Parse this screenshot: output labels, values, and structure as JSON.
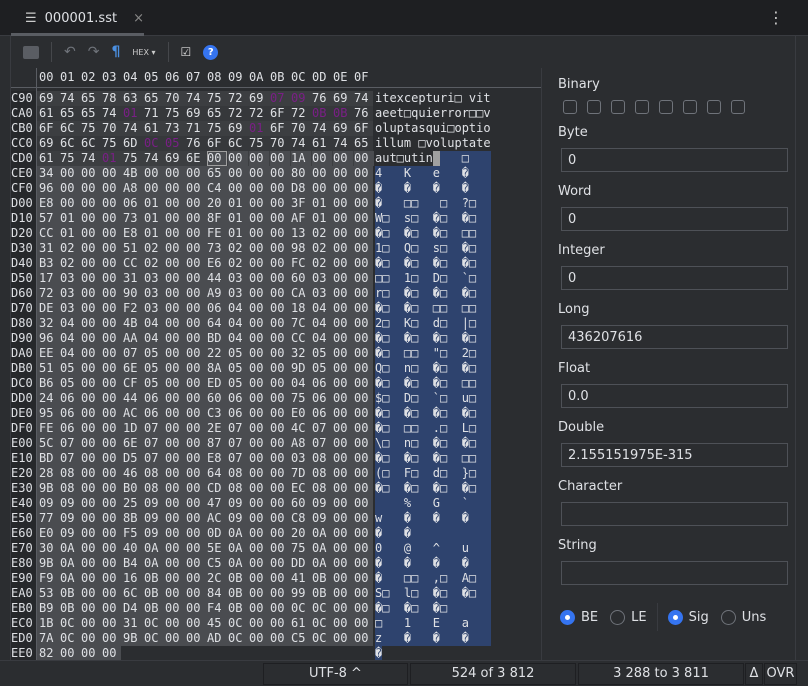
{
  "tab": {
    "title": "000001.sst",
    "close": "×",
    "menu": "⋮"
  },
  "toolbar": {
    "mode": "HEX",
    "icons": [
      "folder-icon",
      "undo-icon",
      "redo-icon",
      "pilcrow-icon",
      "hex-mode-icon",
      "settings-icon",
      "help-icon"
    ]
  },
  "header": [
    "00",
    "01",
    "02",
    "03",
    "04",
    "05",
    "06",
    "07",
    "08",
    "09",
    "0A",
    "0B",
    "0C",
    "0D",
    "0E",
    "0F"
  ],
  "colors": {
    "highlight": "#7a1f86",
    "selection_ascii": "#2e436e",
    "accent": "#3574f0"
  },
  "rows": [
    {
      "o": "C90",
      "h": "69 74 65 78 63 65 70 74 75 72 69 07 09 76 69 74",
      "a": "itexcepturi□ vit"
    },
    {
      "o": "CA0",
      "h": "61 65 65 74 01 71 75 69 65 72 72 6F 72 0B 0B 76",
      "a": "aeet□quierror□□v"
    },
    {
      "o": "CB0",
      "h": "6F 6C 75 70 74 61 73 71 75 69 01 6F 70 74 69 6F",
      "a": "oluptasqui□optio"
    },
    {
      "o": "CC0",
      "h": "69 6C 6C 75 6D 0C 05 76 6F 6C 75 70 74 61 74 65",
      "a": "illum □voluptate"
    },
    {
      "o": "CD0",
      "h": "61 75 74 01 75 74 69 6E 00 00 00 00 1A 00 00 00",
      "a": "aut□utin    □   "
    },
    {
      "o": "CE0",
      "h": "34 00 00 00 4B 00 00 00 65 00 00 00 80 00 00 00",
      "a": "4   K   e   �   "
    },
    {
      "o": "CF0",
      "h": "96 00 00 00 A8 00 00 00 C4 00 00 00 D8 00 00 00",
      "a": "�   �   �   �   "
    },
    {
      "o": "D00",
      "h": "E8 00 00 00 06 01 00 00 20 01 00 00 3F 01 00 00",
      "a": "�   □□   □  ?□  "
    },
    {
      "o": "D10",
      "h": "57 01 00 00 73 01 00 00 8F 01 00 00 AF 01 00 00",
      "a": "W□  s□  �□  �□  "
    },
    {
      "o": "D20",
      "h": "CC 01 00 00 E8 01 00 00 FE 01 00 00 13 02 00 00",
      "a": "�□  �□  �□  □□  "
    },
    {
      "o": "D30",
      "h": "31 02 00 00 51 02 00 00 73 02 00 00 98 02 00 00",
      "a": "1□  Q□  s□  �□  "
    },
    {
      "o": "D40",
      "h": "B3 02 00 00 CC 02 00 00 E6 02 00 00 FC 02 00 00",
      "a": "�□  �□  �□  �□  "
    },
    {
      "o": "D50",
      "h": "17 03 00 00 31 03 00 00 44 03 00 00 60 03 00 00",
      "a": "□□  1□  D□  `□  "
    },
    {
      "o": "D60",
      "h": "72 03 00 00 90 03 00 00 A9 03 00 00 CA 03 00 00",
      "a": "r□  �□  �□  �□  "
    },
    {
      "o": "D70",
      "h": "DE 03 00 00 F2 03 00 00 06 04 00 00 18 04 00 00",
      "a": "�□  �□  □□  □□  "
    },
    {
      "o": "D80",
      "h": "32 04 00 00 4B 04 00 00 64 04 00 00 7C 04 00 00",
      "a": "2□  K□  d□  |□  "
    },
    {
      "o": "D90",
      "h": "96 04 00 00 AA 04 00 00 BD 04 00 00 CC 04 00 00",
      "a": "�□  �□  �□  �□  "
    },
    {
      "o": "DA0",
      "h": "EE 04 00 00 07 05 00 00 22 05 00 00 32 05 00 00",
      "a": "�□  □□  \"□  2□  "
    },
    {
      "o": "DB0",
      "h": "51 05 00 00 6E 05 00 00 8A 05 00 00 9D 05 00 00",
      "a": "Q□  n□  �□  �□  "
    },
    {
      "o": "DC0",
      "h": "B6 05 00 00 CF 05 00 00 ED 05 00 00 04 06 00 00",
      "a": "�□  �□  �□  □□  "
    },
    {
      "o": "DD0",
      "h": "24 06 00 00 44 06 00 00 60 06 00 00 75 06 00 00",
      "a": "$□  D□  `□  u□  "
    },
    {
      "o": "DE0",
      "h": "95 06 00 00 AC 06 00 00 C3 06 00 00 E0 06 00 00",
      "a": "�□  �□  �□  �□  "
    },
    {
      "o": "DF0",
      "h": "FE 06 00 00 1D 07 00 00 2E 07 00 00 4C 07 00 00",
      "a": "�□  □□  .□  L□  "
    },
    {
      "o": "E00",
      "h": "5C 07 00 00 6E 07 00 00 87 07 00 00 A8 07 00 00",
      "a": "\\□  n□  �□  �□  "
    },
    {
      "o": "E10",
      "h": "BD 07 00 00 D5 07 00 00 E8 07 00 00 03 08 00 00",
      "a": "�□  �□  �□  □□  "
    },
    {
      "o": "E20",
      "h": "28 08 00 00 46 08 00 00 64 08 00 00 7D 08 00 00",
      "a": "(□  F□  d□  }□  "
    },
    {
      "o": "E30",
      "h": "9B 08 00 00 B0 08 00 00 CD 08 00 00 EC 08 00 00",
      "a": "�□  �□  �□  �□  "
    },
    {
      "o": "E40",
      "h": "09 09 00 00 25 09 00 00 47 09 00 00 60 09 00 00",
      "a": "    %   G   `   "
    },
    {
      "o": "E50",
      "h": "77 09 00 00 8B 09 00 00 AC 09 00 00 C8 09 00 00",
      "a": "w   �   �   �   "
    },
    {
      "o": "E60",
      "h": "E0 09 00 00 F5 09 00 00 0D 0A 00 00 20 0A 00 00",
      "a": "�   �           "
    },
    {
      "o": "E70",
      "h": "30 0A 00 00 40 0A 00 00 5E 0A 00 00 75 0A 00 00",
      "a": "0   @   ^   u   "
    },
    {
      "o": "E80",
      "h": "9B 0A 00 00 B4 0A 00 00 C5 0A 00 00 DD 0A 00 00",
      "a": "�   �   �   �   "
    },
    {
      "o": "E90",
      "h": "F9 0A 00 00 16 0B 00 00 2C 0B 00 00 41 0B 00 00",
      "a": "�   □□  ,□  A□  "
    },
    {
      "o": "EA0",
      "h": "53 0B 00 00 6C 0B 00 00 84 0B 00 00 99 0B 00 00",
      "a": "S□  l□  �□  �□  "
    },
    {
      "o": "EB0",
      "h": "B9 0B 00 00 D4 0B 00 00 F4 0B 00 00 0C 0C 00 00",
      "a": "�□  �□  �□      "
    },
    {
      "o": "EC0",
      "h": "1B 0C 00 00 31 0C 00 00 45 0C 00 00 61 0C 00 00",
      "a": "□   1   E   a   "
    },
    {
      "o": "ED0",
      "h": "7A 0C 00 00 9B 0C 00 00 AD 0C 00 00 C5 0C 00 00",
      "a": "z   �   �   �   "
    },
    {
      "o": "EE0",
      "h": "82 00 00 00",
      "a": "�"
    }
  ],
  "highlighted": [
    [
      0,
      11
    ],
    [
      0,
      12
    ],
    [
      1,
      4
    ],
    [
      1,
      13
    ],
    [
      1,
      14
    ],
    [
      2,
      10
    ],
    [
      3,
      5
    ],
    [
      3,
      6
    ],
    [
      4,
      3
    ]
  ],
  "cursor": [
    4,
    8
  ],
  "panel": {
    "binary_label": "Binary",
    "binary_bits": [
      0,
      0,
      0,
      0,
      0,
      0,
      0,
      0
    ],
    "fields": [
      {
        "label": "Byte",
        "value": "0"
      },
      {
        "label": "Word",
        "value": "0"
      },
      {
        "label": "Integer",
        "value": "0"
      },
      {
        "label": "Long",
        "value": "436207616"
      },
      {
        "label": "Float",
        "value": "0.0"
      },
      {
        "label": "Double",
        "value": "2.155151975E-315"
      },
      {
        "label": "Character",
        "value": ""
      },
      {
        "label": "String",
        "value": ""
      }
    ],
    "endian": {
      "be": "BE",
      "le": "LE",
      "selected": "BE"
    },
    "sign": {
      "sig": "Sig",
      "uns": "Uns",
      "selected": "Sig"
    }
  },
  "status": {
    "encoding": "UTF-8 ^",
    "position": "524 of 3 812",
    "range": "3 288 to 3 811",
    "delta": "Δ",
    "mode": "OVR"
  }
}
